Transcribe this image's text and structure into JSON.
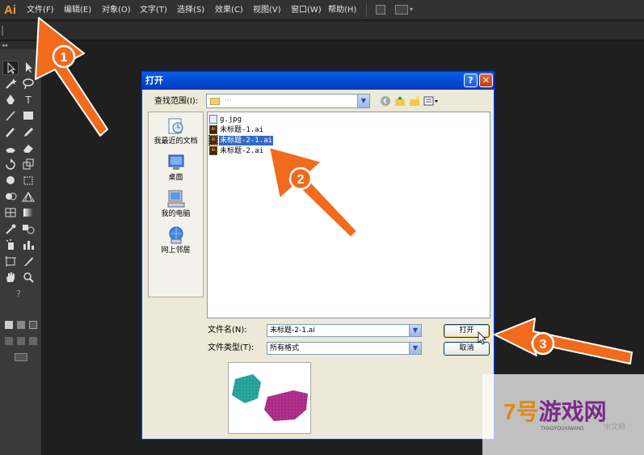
{
  "app": {
    "logo": "Ai"
  },
  "menu": [
    {
      "id": "file",
      "label": "文件(F)"
    },
    {
      "id": "edit",
      "label": "编辑(E)"
    },
    {
      "id": "object",
      "label": "对象(O)"
    },
    {
      "id": "type",
      "label": "文字(T)"
    },
    {
      "id": "select",
      "label": "选择(S)"
    },
    {
      "id": "effect",
      "label": "效果(C)"
    },
    {
      "id": "view",
      "label": "视图(V)"
    },
    {
      "id": "window",
      "label": "窗口(W)"
    },
    {
      "id": "help",
      "label": "帮助(H)"
    }
  ],
  "toolbar": {
    "workspace_arrow": "▾"
  },
  "tools": {
    "type_label": "T",
    "help_label": "?"
  },
  "dialog": {
    "title": "打开",
    "help": "?",
    "close": "✕",
    "look_in_label": "查找范围(I):",
    "look_in_value": "···",
    "places": [
      {
        "label": "我最近的文档",
        "icon": "recent-documents-icon"
      },
      {
        "label": "桌面",
        "icon": "desktop-icon"
      },
      {
        "label": "我的电脑",
        "icon": "my-computer-icon"
      },
      {
        "label": "网上邻居",
        "icon": "network-places-icon"
      }
    ],
    "files": [
      {
        "name": "g.jpg",
        "selected": false
      },
      {
        "name": "未标题-1.ai",
        "selected": false
      },
      {
        "name": "未标题-2-1.ai",
        "selected": true
      },
      {
        "name": "未标题-2.ai",
        "selected": false
      }
    ],
    "filename_label": "文件名(N):",
    "filename_value": "未标题-2-1.ai",
    "filetype_label": "文件类型(T):",
    "filetype_value": "所有格式",
    "open_button": "打开",
    "cancel_button": "取消",
    "file_icon_text": "Ai"
  },
  "annotations": {
    "step1": "1",
    "step2": "2",
    "step3": "3",
    "color": "#f26a1b"
  },
  "watermark": {
    "logo_a": "7号",
    "logo_b": "游戏网",
    "sub": "THAOYOUXIWANG",
    "small": "中文网"
  }
}
